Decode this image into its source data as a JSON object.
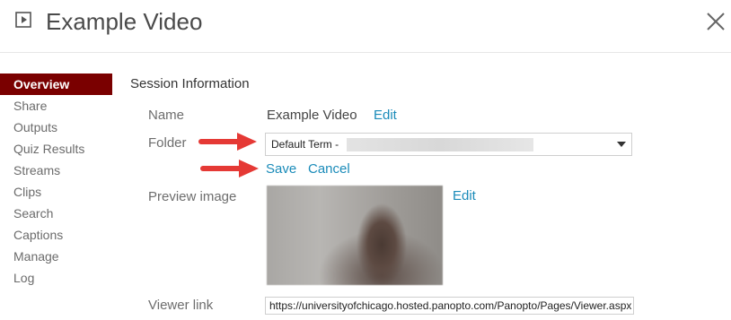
{
  "header": {
    "title": "Example Video",
    "icon": "video-play-icon",
    "close_icon": "close-icon"
  },
  "sidebar": {
    "items": [
      {
        "label": "Overview",
        "active": true
      },
      {
        "label": "Share"
      },
      {
        "label": "Outputs"
      },
      {
        "label": "Quiz Results"
      },
      {
        "label": "Streams"
      },
      {
        "label": "Clips"
      },
      {
        "label": "Search"
      },
      {
        "label": "Captions"
      },
      {
        "label": "Manage"
      },
      {
        "label": "Log"
      }
    ]
  },
  "main": {
    "section_title": "Session Information",
    "name": {
      "label": "Name",
      "value": "Example Video",
      "edit": "Edit"
    },
    "folder": {
      "label": "Folder",
      "selected": "Default Term -",
      "save": "Save",
      "cancel": "Cancel"
    },
    "preview": {
      "label": "Preview image",
      "edit": "Edit"
    },
    "viewer_link": {
      "label": "Viewer link",
      "value": "https://universityofchicago.hosted.panopto.com/Panopto/Pages/Viewer.aspx"
    }
  },
  "colors": {
    "accent": "#7a0000",
    "link": "#1a8bb9",
    "arrow": "#e53935"
  }
}
